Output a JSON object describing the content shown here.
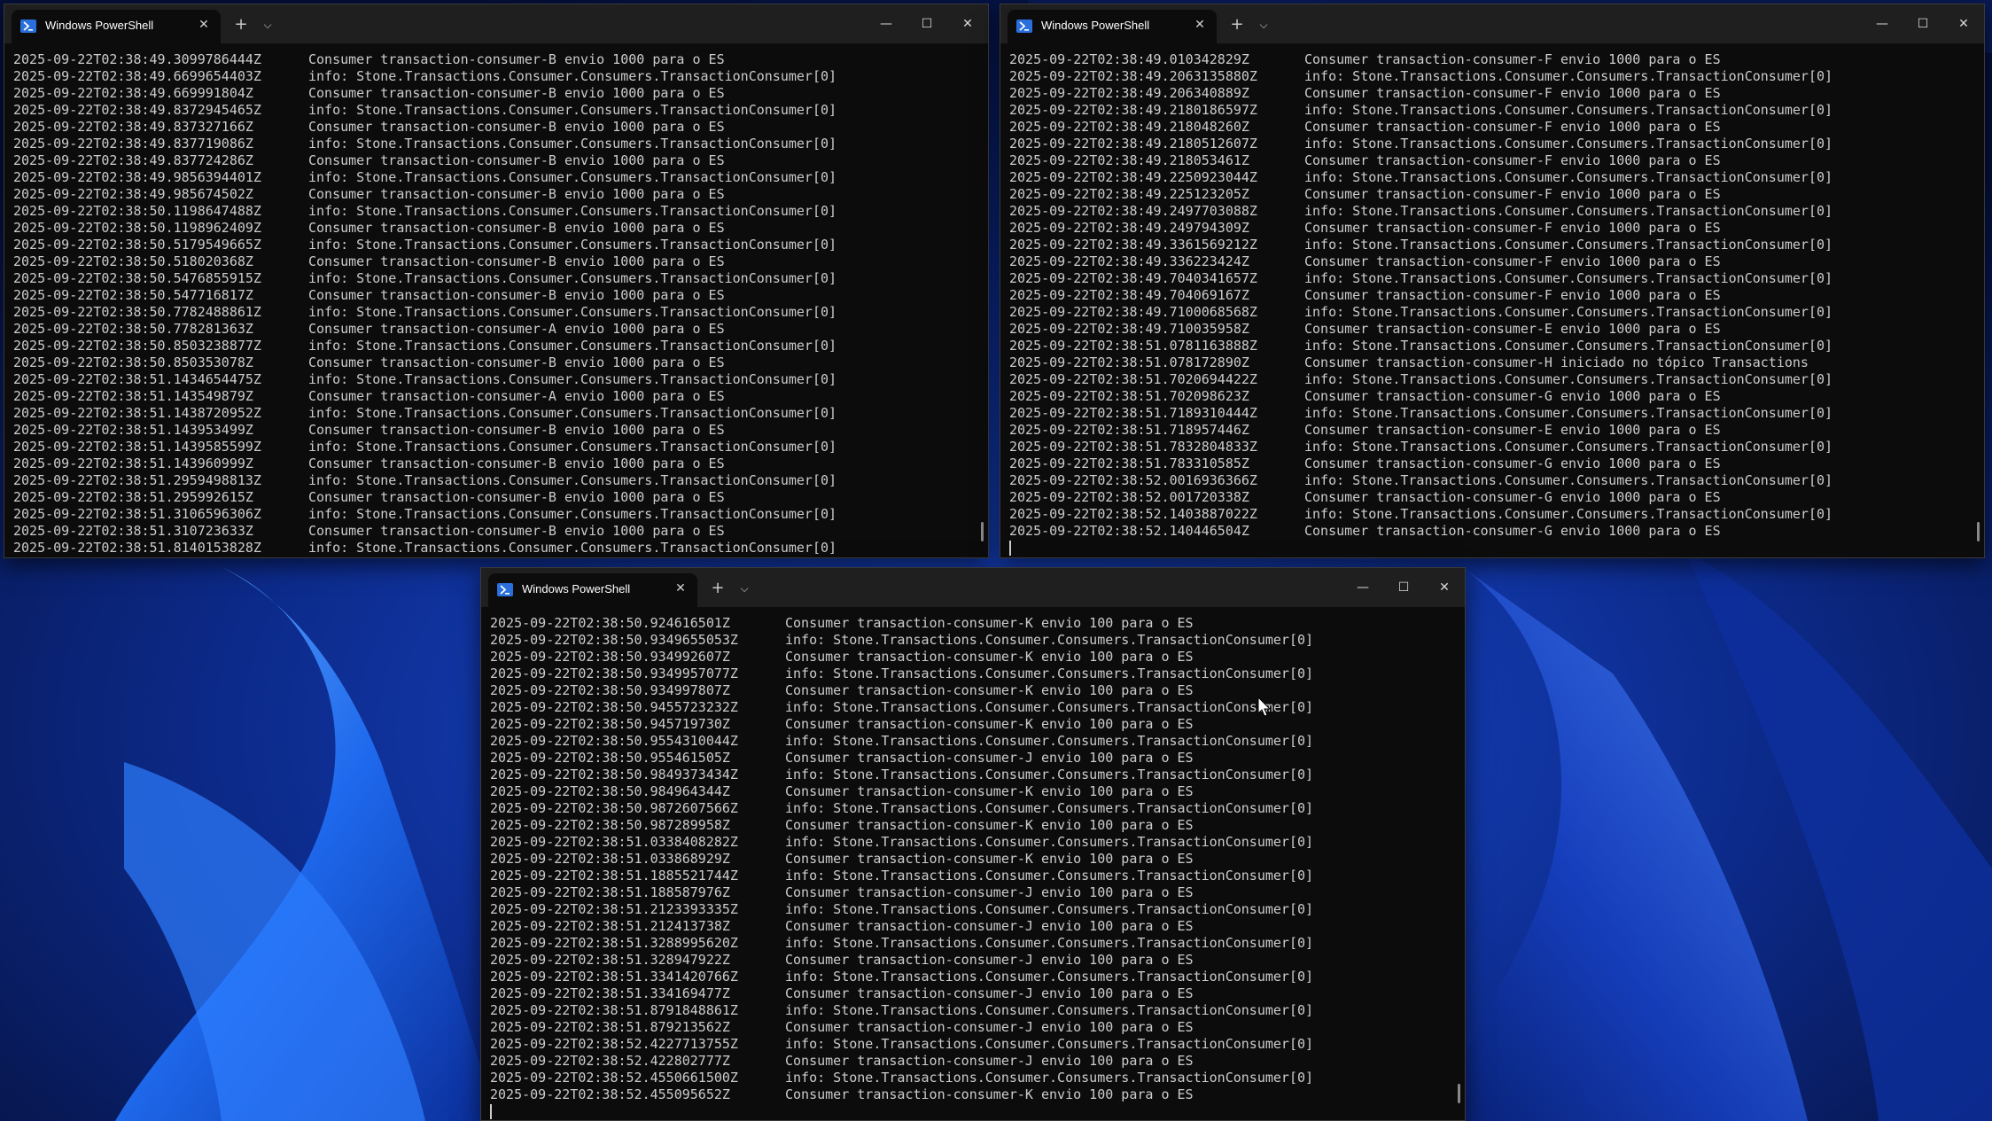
{
  "windows": [
    {
      "tab_title": "Windows PowerShell",
      "lines": [
        {
          "ts": "2025-09-22T02:38:49.3099786444Z",
          "msg": "Consumer transaction-consumer-B envio 1000 para o ES"
        },
        {
          "ts": "2025-09-22T02:38:49.6699654403Z",
          "msg": "info: Stone.Transactions.Consumer.Consumers.TransactionConsumer[0]"
        },
        {
          "ts": "2025-09-22T02:38:49.669991804Z",
          "msg": "Consumer transaction-consumer-B envio 1000 para o ES"
        },
        {
          "ts": "2025-09-22T02:38:49.8372945465Z",
          "msg": "info: Stone.Transactions.Consumer.Consumers.TransactionConsumer[0]"
        },
        {
          "ts": "2025-09-22T02:38:49.837327166Z",
          "msg": "Consumer transaction-consumer-B envio 1000 para o ES"
        },
        {
          "ts": "2025-09-22T02:38:49.837719086Z",
          "msg": "info: Stone.Transactions.Consumer.Consumers.TransactionConsumer[0]"
        },
        {
          "ts": "2025-09-22T02:38:49.837724286Z",
          "msg": "Consumer transaction-consumer-B envio 1000 para o ES"
        },
        {
          "ts": "2025-09-22T02:38:49.9856394401Z",
          "msg": "info: Stone.Transactions.Consumer.Consumers.TransactionConsumer[0]"
        },
        {
          "ts": "2025-09-22T02:38:49.985674502Z",
          "msg": "Consumer transaction-consumer-B envio 1000 para o ES"
        },
        {
          "ts": "2025-09-22T02:38:50.1198647488Z",
          "msg": "info: Stone.Transactions.Consumer.Consumers.TransactionConsumer[0]"
        },
        {
          "ts": "2025-09-22T02:38:50.1198962409Z",
          "msg": "Consumer transaction-consumer-B envio 1000 para o ES"
        },
        {
          "ts": "2025-09-22T02:38:50.5179549665Z",
          "msg": "info: Stone.Transactions.Consumer.Consumers.TransactionConsumer[0]"
        },
        {
          "ts": "2025-09-22T02:38:50.518020368Z",
          "msg": "Consumer transaction-consumer-B envio 1000 para o ES"
        },
        {
          "ts": "2025-09-22T02:38:50.5476855915Z",
          "msg": "info: Stone.Transactions.Consumer.Consumers.TransactionConsumer[0]"
        },
        {
          "ts": "2025-09-22T02:38:50.547716817Z",
          "msg": "Consumer transaction-consumer-B envio 1000 para o ES"
        },
        {
          "ts": "2025-09-22T02:38:50.7782488861Z",
          "msg": "info: Stone.Transactions.Consumer.Consumers.TransactionConsumer[0]"
        },
        {
          "ts": "2025-09-22T02:38:50.778281363Z",
          "msg": "Consumer transaction-consumer-A envio 1000 para o ES"
        },
        {
          "ts": "2025-09-22T02:38:50.8503238877Z",
          "msg": "info: Stone.Transactions.Consumer.Consumers.TransactionConsumer[0]"
        },
        {
          "ts": "2025-09-22T02:38:50.850353078Z",
          "msg": "Consumer transaction-consumer-B envio 1000 para o ES"
        },
        {
          "ts": "2025-09-22T02:38:51.1434654475Z",
          "msg": "info: Stone.Transactions.Consumer.Consumers.TransactionConsumer[0]"
        },
        {
          "ts": "2025-09-22T02:38:51.143549879Z",
          "msg": "Consumer transaction-consumer-A envio 1000 para o ES"
        },
        {
          "ts": "2025-09-22T02:38:51.1438720952Z",
          "msg": "info: Stone.Transactions.Consumer.Consumers.TransactionConsumer[0]"
        },
        {
          "ts": "2025-09-22T02:38:51.143953499Z",
          "msg": "Consumer transaction-consumer-B envio 1000 para o ES"
        },
        {
          "ts": "2025-09-22T02:38:51.1439585599Z",
          "msg": "info: Stone.Transactions.Consumer.Consumers.TransactionConsumer[0]"
        },
        {
          "ts": "2025-09-22T02:38:51.143960999Z",
          "msg": "Consumer transaction-consumer-B envio 1000 para o ES"
        },
        {
          "ts": "2025-09-22T02:38:51.2959498813Z",
          "msg": "info: Stone.Transactions.Consumer.Consumers.TransactionConsumer[0]"
        },
        {
          "ts": "2025-09-22T02:38:51.295992615Z",
          "msg": "Consumer transaction-consumer-B envio 1000 para o ES"
        },
        {
          "ts": "2025-09-22T02:38:51.3106596306Z",
          "msg": "info: Stone.Transactions.Consumer.Consumers.TransactionConsumer[0]"
        },
        {
          "ts": "2025-09-22T02:38:51.310723633Z",
          "msg": "Consumer transaction-consumer-B envio 1000 para o ES"
        },
        {
          "ts": "2025-09-22T02:38:51.8140153828Z",
          "msg": "info: Stone.Transactions.Consumer.Consumers.TransactionConsumer[0]"
        }
      ]
    },
    {
      "tab_title": "Windows PowerShell",
      "lines": [
        {
          "ts": "2025-09-22T02:38:49.010342829Z",
          "msg": "Consumer transaction-consumer-F envio 1000 para o ES"
        },
        {
          "ts": "2025-09-22T02:38:49.2063135880Z",
          "msg": "info: Stone.Transactions.Consumer.Consumers.TransactionConsumer[0]"
        },
        {
          "ts": "2025-09-22T02:38:49.206340889Z",
          "msg": "Consumer transaction-consumer-F envio 1000 para o ES"
        },
        {
          "ts": "2025-09-22T02:38:49.2180186597Z",
          "msg": "info: Stone.Transactions.Consumer.Consumers.TransactionConsumer[0]"
        },
        {
          "ts": "2025-09-22T02:38:49.218048260Z",
          "msg": "Consumer transaction-consumer-F envio 1000 para o ES"
        },
        {
          "ts": "2025-09-22T02:38:49.2180512607Z",
          "msg": "info: Stone.Transactions.Consumer.Consumers.TransactionConsumer[0]"
        },
        {
          "ts": "2025-09-22T02:38:49.218053461Z",
          "msg": "Consumer transaction-consumer-F envio 1000 para o ES"
        },
        {
          "ts": "2025-09-22T02:38:49.2250923044Z",
          "msg": "info: Stone.Transactions.Consumer.Consumers.TransactionConsumer[0]"
        },
        {
          "ts": "2025-09-22T02:38:49.225123205Z",
          "msg": "Consumer transaction-consumer-F envio 1000 para o ES"
        },
        {
          "ts": "2025-09-22T02:38:49.2497703088Z",
          "msg": "info: Stone.Transactions.Consumer.Consumers.TransactionConsumer[0]"
        },
        {
          "ts": "2025-09-22T02:38:49.249794309Z",
          "msg": "Consumer transaction-consumer-F envio 1000 para o ES"
        },
        {
          "ts": "2025-09-22T02:38:49.3361569212Z",
          "msg": "info: Stone.Transactions.Consumer.Consumers.TransactionConsumer[0]"
        },
        {
          "ts": "2025-09-22T02:38:49.336223424Z",
          "msg": "Consumer transaction-consumer-F envio 1000 para o ES"
        },
        {
          "ts": "2025-09-22T02:38:49.7040341657Z",
          "msg": "info: Stone.Transactions.Consumer.Consumers.TransactionConsumer[0]"
        },
        {
          "ts": "2025-09-22T02:38:49.704069167Z",
          "msg": "Consumer transaction-consumer-F envio 1000 para o ES"
        },
        {
          "ts": "2025-09-22T02:38:49.7100068568Z",
          "msg": "info: Stone.Transactions.Consumer.Consumers.TransactionConsumer[0]"
        },
        {
          "ts": "2025-09-22T02:38:49.710035958Z",
          "msg": "Consumer transaction-consumer-E envio 1000 para o ES"
        },
        {
          "ts": "2025-09-22T02:38:51.0781163888Z",
          "msg": "info: Stone.Transactions.Consumer.Consumers.TransactionConsumer[0]"
        },
        {
          "ts": "2025-09-22T02:38:51.078172890Z",
          "msg": "Consumer transaction-consumer-H iniciado no tópico Transactions"
        },
        {
          "ts": "2025-09-22T02:38:51.7020694422Z",
          "msg": "info: Stone.Transactions.Consumer.Consumers.TransactionConsumer[0]"
        },
        {
          "ts": "2025-09-22T02:38:51.702098623Z",
          "msg": "Consumer transaction-consumer-G envio 1000 para o ES"
        },
        {
          "ts": "2025-09-22T02:38:51.7189310444Z",
          "msg": "info: Stone.Transactions.Consumer.Consumers.TransactionConsumer[0]"
        },
        {
          "ts": "2025-09-22T02:38:51.718957446Z",
          "msg": "Consumer transaction-consumer-E envio 1000 para o ES"
        },
        {
          "ts": "2025-09-22T02:38:51.7832804833Z",
          "msg": "info: Stone.Transactions.Consumer.Consumers.TransactionConsumer[0]"
        },
        {
          "ts": "2025-09-22T02:38:51.783310585Z",
          "msg": "Consumer transaction-consumer-G envio 1000 para o ES"
        },
        {
          "ts": "2025-09-22T02:38:52.0016936366Z",
          "msg": "info: Stone.Transactions.Consumer.Consumers.TransactionConsumer[0]"
        },
        {
          "ts": "2025-09-22T02:38:52.001720338Z",
          "msg": "Consumer transaction-consumer-G envio 1000 para o ES"
        },
        {
          "ts": "2025-09-22T02:38:52.1403887022Z",
          "msg": "info: Stone.Transactions.Consumer.Consumers.TransactionConsumer[0]"
        },
        {
          "ts": "2025-09-22T02:38:52.140446504Z",
          "msg": "Consumer transaction-consumer-G envio 1000 para o ES"
        }
      ]
    },
    {
      "tab_title": "Windows PowerShell",
      "lines": [
        {
          "ts": "2025-09-22T02:38:50.924616501Z",
          "msg": "Consumer transaction-consumer-K envio 100 para o ES"
        },
        {
          "ts": "2025-09-22T02:38:50.9349655053Z",
          "msg": "info: Stone.Transactions.Consumer.Consumers.TransactionConsumer[0]"
        },
        {
          "ts": "2025-09-22T02:38:50.934992607Z",
          "msg": "Consumer transaction-consumer-K envio 100 para o ES"
        },
        {
          "ts": "2025-09-22T02:38:50.9349957077Z",
          "msg": "info: Stone.Transactions.Consumer.Consumers.TransactionConsumer[0]"
        },
        {
          "ts": "2025-09-22T02:38:50.934997807Z",
          "msg": "Consumer transaction-consumer-K envio 100 para o ES"
        },
        {
          "ts": "2025-09-22T02:38:50.9455723232Z",
          "msg": "info: Stone.Transactions.Consumer.Consumers.TransactionConsumer[0]"
        },
        {
          "ts": "2025-09-22T02:38:50.945719730Z",
          "msg": "Consumer transaction-consumer-K envio 100 para o ES"
        },
        {
          "ts": "2025-09-22T02:38:50.9554310044Z",
          "msg": "info: Stone.Transactions.Consumer.Consumers.TransactionConsumer[0]"
        },
        {
          "ts": "2025-09-22T02:38:50.955461505Z",
          "msg": "Consumer transaction-consumer-J envio 100 para o ES"
        },
        {
          "ts": "2025-09-22T02:38:50.9849373434Z",
          "msg": "info: Stone.Transactions.Consumer.Consumers.TransactionConsumer[0]"
        },
        {
          "ts": "2025-09-22T02:38:50.984964344Z",
          "msg": "Consumer transaction-consumer-K envio 100 para o ES"
        },
        {
          "ts": "2025-09-22T02:38:50.9872607566Z",
          "msg": "info: Stone.Transactions.Consumer.Consumers.TransactionConsumer[0]"
        },
        {
          "ts": "2025-09-22T02:38:50.987289958Z",
          "msg": "Consumer transaction-consumer-K envio 100 para o ES"
        },
        {
          "ts": "2025-09-22T02:38:51.0338408282Z",
          "msg": "info: Stone.Transactions.Consumer.Consumers.TransactionConsumer[0]"
        },
        {
          "ts": "2025-09-22T02:38:51.033868929Z",
          "msg": "Consumer transaction-consumer-K envio 100 para o ES"
        },
        {
          "ts": "2025-09-22T02:38:51.1885521744Z",
          "msg": "info: Stone.Transactions.Consumer.Consumers.TransactionConsumer[0]"
        },
        {
          "ts": "2025-09-22T02:38:51.188587976Z",
          "msg": "Consumer transaction-consumer-J envio 100 para o ES"
        },
        {
          "ts": "2025-09-22T02:38:51.2123393335Z",
          "msg": "info: Stone.Transactions.Consumer.Consumers.TransactionConsumer[0]"
        },
        {
          "ts": "2025-09-22T02:38:51.212413738Z",
          "msg": "Consumer transaction-consumer-J envio 100 para o ES"
        },
        {
          "ts": "2025-09-22T02:38:51.3288995620Z",
          "msg": "info: Stone.Transactions.Consumer.Consumers.TransactionConsumer[0]"
        },
        {
          "ts": "2025-09-22T02:38:51.328947922Z",
          "msg": "Consumer transaction-consumer-J envio 100 para o ES"
        },
        {
          "ts": "2025-09-22T02:38:51.3341420766Z",
          "msg": "info: Stone.Transactions.Consumer.Consumers.TransactionConsumer[0]"
        },
        {
          "ts": "2025-09-22T02:38:51.334169477Z",
          "msg": "Consumer transaction-consumer-J envio 100 para o ES"
        },
        {
          "ts": "2025-09-22T02:38:51.8791848861Z",
          "msg": "info: Stone.Transactions.Consumer.Consumers.TransactionConsumer[0]"
        },
        {
          "ts": "2025-09-22T02:38:51.879213562Z",
          "msg": "Consumer transaction-consumer-J envio 100 para o ES"
        },
        {
          "ts": "2025-09-22T02:38:52.4227713755Z",
          "msg": "info: Stone.Transactions.Consumer.Consumers.TransactionConsumer[0]"
        },
        {
          "ts": "2025-09-22T02:38:52.422802777Z",
          "msg": "Consumer transaction-consumer-J envio 100 para o ES"
        },
        {
          "ts": "2025-09-22T02:38:52.4550661500Z",
          "msg": "info: Stone.Transactions.Consumer.Consumers.TransactionConsumer[0]"
        },
        {
          "ts": "2025-09-22T02:38:52.455095652Z",
          "msg": "Consumer transaction-consumer-K envio 100 para o ES"
        }
      ]
    }
  ],
  "icons": {
    "powershell": "powershell-icon",
    "close_tab": "close-icon",
    "new_tab": "plus-icon",
    "dropdown": "chevron-down-icon",
    "minimize": "minimize-icon",
    "maximize": "maximize-icon",
    "close_window": "close-icon"
  },
  "colors": {
    "terminal_bg": "#0c0c0c",
    "terminal_fg": "#cccccc",
    "titlebar_bg": "#1f1f1f",
    "wallpaper_accent": "#1e6bff"
  }
}
